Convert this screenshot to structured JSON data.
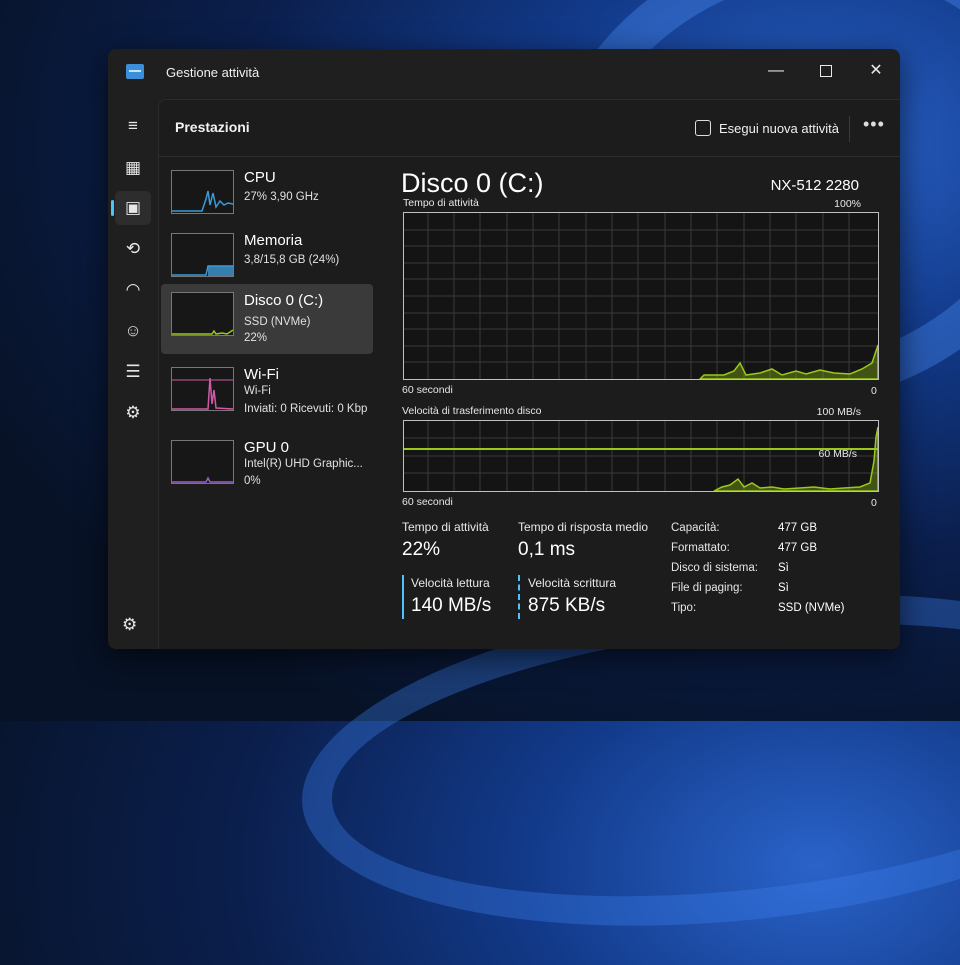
{
  "window": {
    "title": "Gestione attività",
    "controls": {
      "minimize": "—",
      "maximize": "",
      "close": "✕"
    }
  },
  "nav": {
    "items": [
      {
        "name": "menu-icon",
        "glyph": "≡"
      },
      {
        "name": "processes-icon",
        "glyph": "▦"
      },
      {
        "name": "performance-icon",
        "glyph": "▣"
      },
      {
        "name": "history-icon",
        "glyph": "⟲"
      },
      {
        "name": "startup-icon",
        "glyph": "◠"
      },
      {
        "name": "users-icon",
        "glyph": "☺"
      },
      {
        "name": "details-icon",
        "glyph": "☰"
      },
      {
        "name": "services-icon",
        "glyph": "⚙"
      }
    ],
    "settings_glyph": "⚙"
  },
  "header": {
    "title": "Prestazioni",
    "run_task": "Esegui nuova attività",
    "more": "•••"
  },
  "devices": [
    {
      "name": "CPU",
      "line1": "27% 3,90 GHz",
      "line2": "",
      "graph_color": "#3d9ad6"
    },
    {
      "name": "Memoria",
      "line1": "3,8/15,8 GB (24%)",
      "line2": "",
      "graph_color": "#3d9ad6"
    },
    {
      "name": "Disco 0 (C:)",
      "line1": "SSD (NVMe)",
      "line2": "22%",
      "graph_color": "#9ac91a"
    },
    {
      "name": "Wi-Fi",
      "line1": "Wi-Fi",
      "line2": "Inviati: 0 Ricevuti: 0 Kbp",
      "graph_color": "#d05aa8"
    },
    {
      "name": "GPU 0",
      "line1": "Intel(R) UHD Graphic...",
      "line2": "0%",
      "graph_color": "#9b5fd0"
    }
  ],
  "detail": {
    "title": "Disco 0 (C:)",
    "model": "NX-512 2280",
    "activity_graph": {
      "label": "Tempo di attività",
      "max_label": "100%",
      "time_label": "60 secondi",
      "min_label": "0"
    },
    "transfer_graph": {
      "label": "Velocità di trasferimento disco",
      "max_label": "100 MB/s",
      "marker_label": "60 MB/s",
      "time_label": "60 secondi",
      "min_label": "0"
    },
    "stats": {
      "active_time_label": "Tempo di attività",
      "active_time_value": "22%",
      "response_label": "Tempo di risposta medio",
      "response_value": "0,1 ms",
      "read_label": "Velocità lettura",
      "read_value": "140 MB/s",
      "write_label": "Velocità scrittura",
      "write_value": "875 KB/s"
    },
    "properties": [
      {
        "key": "Capacità:",
        "value": "477 GB"
      },
      {
        "key": "Formattato:",
        "value": "477 GB"
      },
      {
        "key": "Disco di sistema:",
        "value": "Sì"
      },
      {
        "key": "File di paging:",
        "value": "Sì"
      },
      {
        "key": "Tipo:",
        "value": "SSD (NVMe)"
      }
    ]
  },
  "colors": {
    "accent": "#4cc2ff",
    "disk_green": "#9ac91a",
    "window_bg": "#1f1f1f"
  }
}
